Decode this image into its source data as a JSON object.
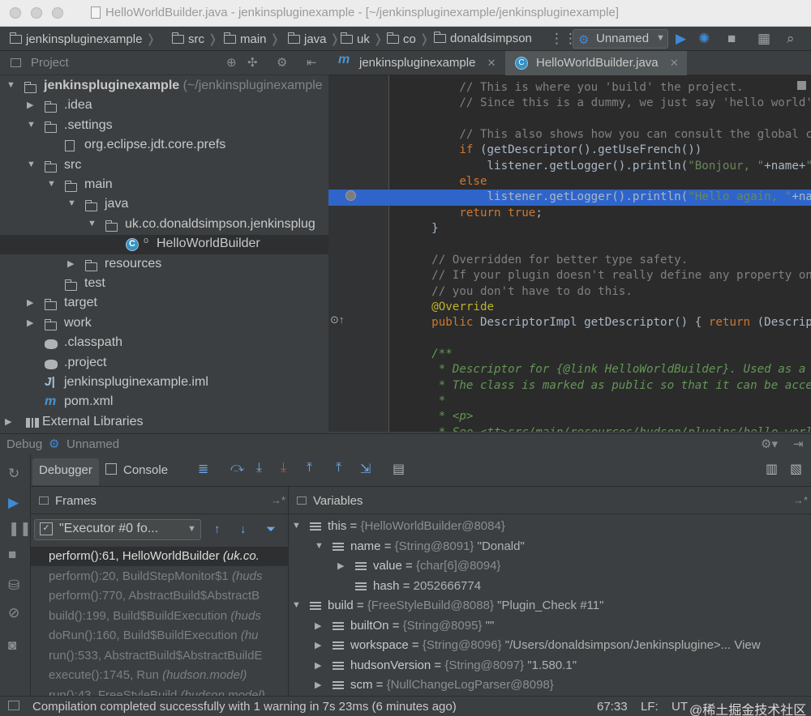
{
  "window": {
    "title": "HelloWorldBuilder.java - jenkinspluginexample - [~/jenkinspluginexample/jenkinspluginexample]"
  },
  "navbar": {
    "crumbs": [
      "jenkinspluginexample",
      "src",
      "main",
      "java",
      "uk",
      "co",
      "donaldsimpson"
    ],
    "run_config": "Unnamed"
  },
  "project_panel": {
    "title": "Project",
    "tree": [
      {
        "text": "jenkinspluginexample",
        "hint": " (~/jenkinspluginexample",
        "indent": 0
      },
      {
        "text": ".idea",
        "indent": 1
      },
      {
        "text": ".settings",
        "indent": 1
      },
      {
        "text": "org.eclipse.jdt.core.prefs",
        "indent": 2
      },
      {
        "text": "src",
        "indent": 1
      },
      {
        "text": "main",
        "indent": 2
      },
      {
        "text": "java",
        "indent": 3
      },
      {
        "text": "uk.co.donaldsimpson.jenkinsplug",
        "indent": 4
      },
      {
        "text": "HelloWorldBuilder",
        "indent": 5
      },
      {
        "text": "resources",
        "indent": 3
      },
      {
        "text": "test",
        "indent": 2
      },
      {
        "text": "target",
        "indent": 1
      },
      {
        "text": "work",
        "indent": 1
      },
      {
        "text": ".classpath",
        "indent": 1
      },
      {
        "text": ".project",
        "indent": 1
      },
      {
        "text": "jenkinspluginexample.iml",
        "indent": 1
      },
      {
        "text": "pom.xml",
        "indent": 1
      },
      {
        "text": "External Libraries",
        "indent": 0
      }
    ]
  },
  "editor": {
    "tabs": [
      {
        "label": "jenkinspluginexample",
        "icon": "maven-icon"
      },
      {
        "label": "HelloWorldBuilder.java",
        "icon": "class-icon"
      }
    ],
    "lines": [
      "        // This is where you 'build' the project.",
      "        // Since this is a dummy, we just say 'hello world'",
      "",
      "        // This also shows how you can consult the global co",
      "        if (getDescriptor().getUseFrench())",
      "            listener.getLogger().println(\"Bonjour, \"+name+\"!",
      "        else",
      "            listener.getLogger().println(\"Hello again, \"+nam",
      "        return true;",
      "    }",
      "",
      "    // Overridden for better type safety.",
      "    // If your plugin doesn't really define any property on",
      "    // you don't have to do this.",
      "    @Override",
      "    public DescriptorImpl getDescriptor() { return (Descript",
      "",
      "    /**",
      "     * Descriptor for {@link HelloWorldBuilder}. Used as a s",
      "     * The class is marked as public so that it can be acces",
      "     *",
      "     * <p>",
      "     * See <tt>src/main/resources/hudson/plugins/hello_world"
    ]
  },
  "debug": {
    "title": "Debug",
    "config": "Unnamed",
    "tabs": [
      "Debugger",
      "Console"
    ],
    "frames_title": "Frames",
    "thread": "\"Executor #0 fo...",
    "frames": [
      {
        "method": "perform():61, HelloWorldBuilder",
        "pkg": "(uk.co."
      },
      {
        "method": "perform():20, BuildStepMonitor$1",
        "pkg": "(huds"
      },
      {
        "method": "perform():770, AbstractBuild$AbstractB",
        "pkg": ""
      },
      {
        "method": "build():199, Build$BuildExecution",
        "pkg": "(huds"
      },
      {
        "method": "doRun():160, Build$BuildExecution",
        "pkg": "(hu"
      },
      {
        "method": "run():533, AbstractBuild$AbstractBuildE",
        "pkg": ""
      },
      {
        "method": "execute():1745, Run",
        "pkg": "(hudson.model)"
      },
      {
        "method": "run():43, FreeStyleBuild",
        "pkg": "(hudson.model)"
      }
    ],
    "variables_title": "Variables",
    "variables": [
      {
        "indent": 0,
        "expand": "open",
        "name": "this",
        "type": "{HelloWorldBuilder@8084}",
        "val": ""
      },
      {
        "indent": 1,
        "expand": "open",
        "name": "name",
        "type": "{String@8091}",
        "val": "\"Donald\""
      },
      {
        "indent": 2,
        "expand": "closed",
        "name": "value",
        "type": "{char[6]@8094}",
        "val": ""
      },
      {
        "indent": 2,
        "expand": "none",
        "name": "hash",
        "type": "",
        "val": "2052666774"
      },
      {
        "indent": 0,
        "expand": "open",
        "name": "build",
        "type": "{FreeStyleBuild@8088}",
        "val": "\"Plugin_Check #11\""
      },
      {
        "indent": 1,
        "expand": "closed",
        "name": "builtOn",
        "type": "{String@8095}",
        "val": "\"\""
      },
      {
        "indent": 1,
        "expand": "closed",
        "name": "workspace",
        "type": "{String@8096}",
        "val": "\"/Users/donaldsimpson/Jenkinsplugine>... View"
      },
      {
        "indent": 1,
        "expand": "closed",
        "name": "hudsonVersion",
        "type": "{String@8097}",
        "val": "\"1.580.1\""
      },
      {
        "indent": 1,
        "expand": "closed",
        "name": "scm",
        "type": "{NullChangeLogParser@8098}",
        "val": ""
      }
    ]
  },
  "status": {
    "message": "Compilation completed successfully with 1 warning in 7s 23ms (6 minutes ago)",
    "position": "67:33",
    "line_sep": "LF:",
    "encoding": "UT",
    "watermark": "@稀土掘金技术社区"
  }
}
